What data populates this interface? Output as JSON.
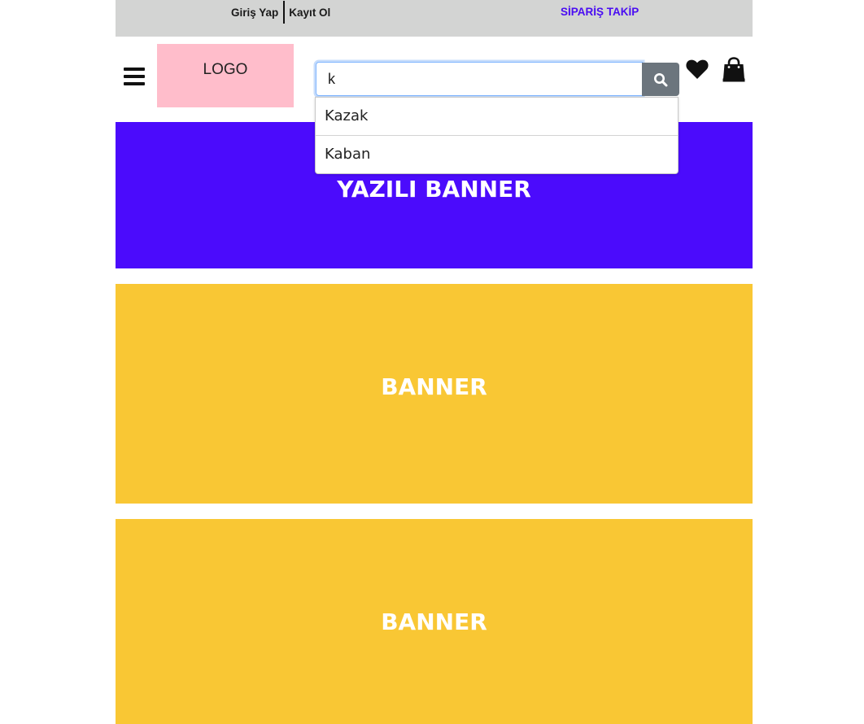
{
  "topbar": {
    "login_label": "Giriş Yap",
    "register_label": "Kayıt Ol",
    "order_tracking_label": "SİPARİŞ TAKİP"
  },
  "header": {
    "logo_text": "LOGO",
    "search": {
      "value": "k",
      "placeholder": ""
    },
    "icons": {
      "menu": "hamburger-menu-icon",
      "search": "search-icon",
      "favorites": "heart-icon",
      "cart": "shopping-bag-icon"
    }
  },
  "search_suggestions": [
    {
      "label": "Kazak"
    },
    {
      "label": "Kaban"
    }
  ],
  "banners": [
    {
      "label": "YAZILI BANNER",
      "color": "#4b0bfc"
    },
    {
      "label": "BANNER",
      "color": "#f9c734"
    },
    {
      "label": "BANNER",
      "color": "#f9c734"
    }
  ],
  "colors": {
    "topbar_bg": "#d3d4d3",
    "accent": "#4a0df2",
    "logo_bg": "#ffbdcb",
    "search_button": "#6c757d"
  }
}
